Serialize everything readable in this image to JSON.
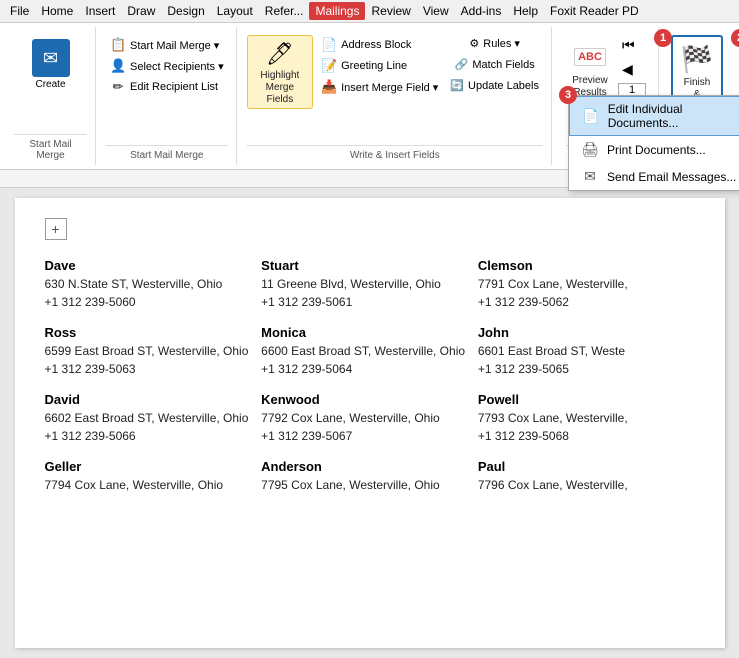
{
  "menubar": {
    "items": [
      "File",
      "Home",
      "Insert",
      "Draw",
      "Design",
      "Layout",
      "References",
      "Mailings",
      "Review",
      "View",
      "Add-ins",
      "Help",
      "Foxit Reader PD"
    ]
  },
  "mailings_tab": "Mailings",
  "ribbon": {
    "groups": [
      {
        "label": "Start Mail Merge",
        "buttons": [
          {
            "id": "create",
            "label": "Create",
            "icon": "✉"
          },
          {
            "id": "start-mail-merge",
            "label": "Start Mail Merge",
            "icon": "📋",
            "has_arrow": true
          },
          {
            "id": "select-recipients",
            "label": "Select Recipients",
            "icon": "👤",
            "has_arrow": true
          },
          {
            "id": "edit-recipient-list",
            "label": "Edit Recipient List",
            "icon": "✏"
          }
        ]
      },
      {
        "label": "Write & Insert Fields",
        "buttons": [
          {
            "id": "highlight-merge",
            "label": "Highlight Merge Fields",
            "icon": "🖊"
          },
          {
            "id": "address-block",
            "label": "Address Block",
            "icon": "📄"
          },
          {
            "id": "greeting-line",
            "label": "Greeting Line",
            "icon": "📝"
          },
          {
            "id": "insert-merge-field",
            "label": "Insert Merge Field",
            "icon": "📥",
            "has_arrow": true
          }
        ]
      },
      {
        "label": "Preview Results",
        "id": "preview-results-group",
        "buttons": [
          {
            "id": "preview-results-btn",
            "label": "Preview\nResults",
            "icon": "ABC"
          }
        ],
        "badge": "1"
      },
      {
        "label": "Finish",
        "buttons": [
          {
            "id": "finish-merge-btn",
            "label": "Finish &\nMerge",
            "icon": "🏁"
          }
        ],
        "badge": "2"
      }
    ]
  },
  "dropdown": {
    "items": [
      {
        "id": "edit-individual",
        "label": "Edit Individual Documents...",
        "icon": "📄",
        "highlighted": true
      },
      {
        "id": "print-documents",
        "label": "Print Documents...",
        "icon": "🖨"
      },
      {
        "id": "send-email",
        "label": "Send Email Messages...",
        "icon": "✉"
      }
    ]
  },
  "badges": {
    "one": "1",
    "two": "2",
    "three": "3"
  },
  "document": {
    "contacts": [
      {
        "name": "Dave",
        "address": "630 N.State ST, Westerville, Ohio",
        "phone": "+1 312 239-5060"
      },
      {
        "name": "Stuart",
        "address": "11 Greene Blvd, Westerville, Ohio",
        "phone": "+1 312 239-5061"
      },
      {
        "name": "Clemson",
        "address": "7791 Cox Lane, Westerville,",
        "phone": "+1 312 239-5062"
      },
      {
        "name": "Ross",
        "address": "6599 East Broad ST, Westerville, Ohio",
        "phone": "+1 312 239-5063"
      },
      {
        "name": "Monica",
        "address": "6600 East Broad ST, Westerville, Ohio",
        "phone": "+1 312 239-5064"
      },
      {
        "name": "John",
        "address": "6601 East Broad ST, Weste",
        "phone": "+1 312 239-5065"
      },
      {
        "name": "David",
        "address": "6602 East Broad ST, Westerville, Ohio",
        "phone": "+1 312 239-5066"
      },
      {
        "name": "Kenwood",
        "address": "7792 Cox Lane, Westerville, Ohio",
        "phone": "+1 312 239-5067"
      },
      {
        "name": "Powell",
        "address": "7793 Cox Lane, Westerville,",
        "phone": "+1 312 239-5068"
      },
      {
        "name": "Geller",
        "address": "7794 Cox Lane, Westerville, Ohio",
        "phone": ""
      },
      {
        "name": "Anderson",
        "address": "7795 Cox Lane, Westerville, Ohio",
        "phone": ""
      },
      {
        "name": "Paul",
        "address": "7796 Cox Lane, Westerville,",
        "phone": ""
      }
    ]
  },
  "colors": {
    "active_tab_bg": "#d83b3b",
    "ribbon_highlight": "#fff3cc",
    "accent_blue": "#1e6ab0",
    "badge_red": "#d83b3b"
  }
}
